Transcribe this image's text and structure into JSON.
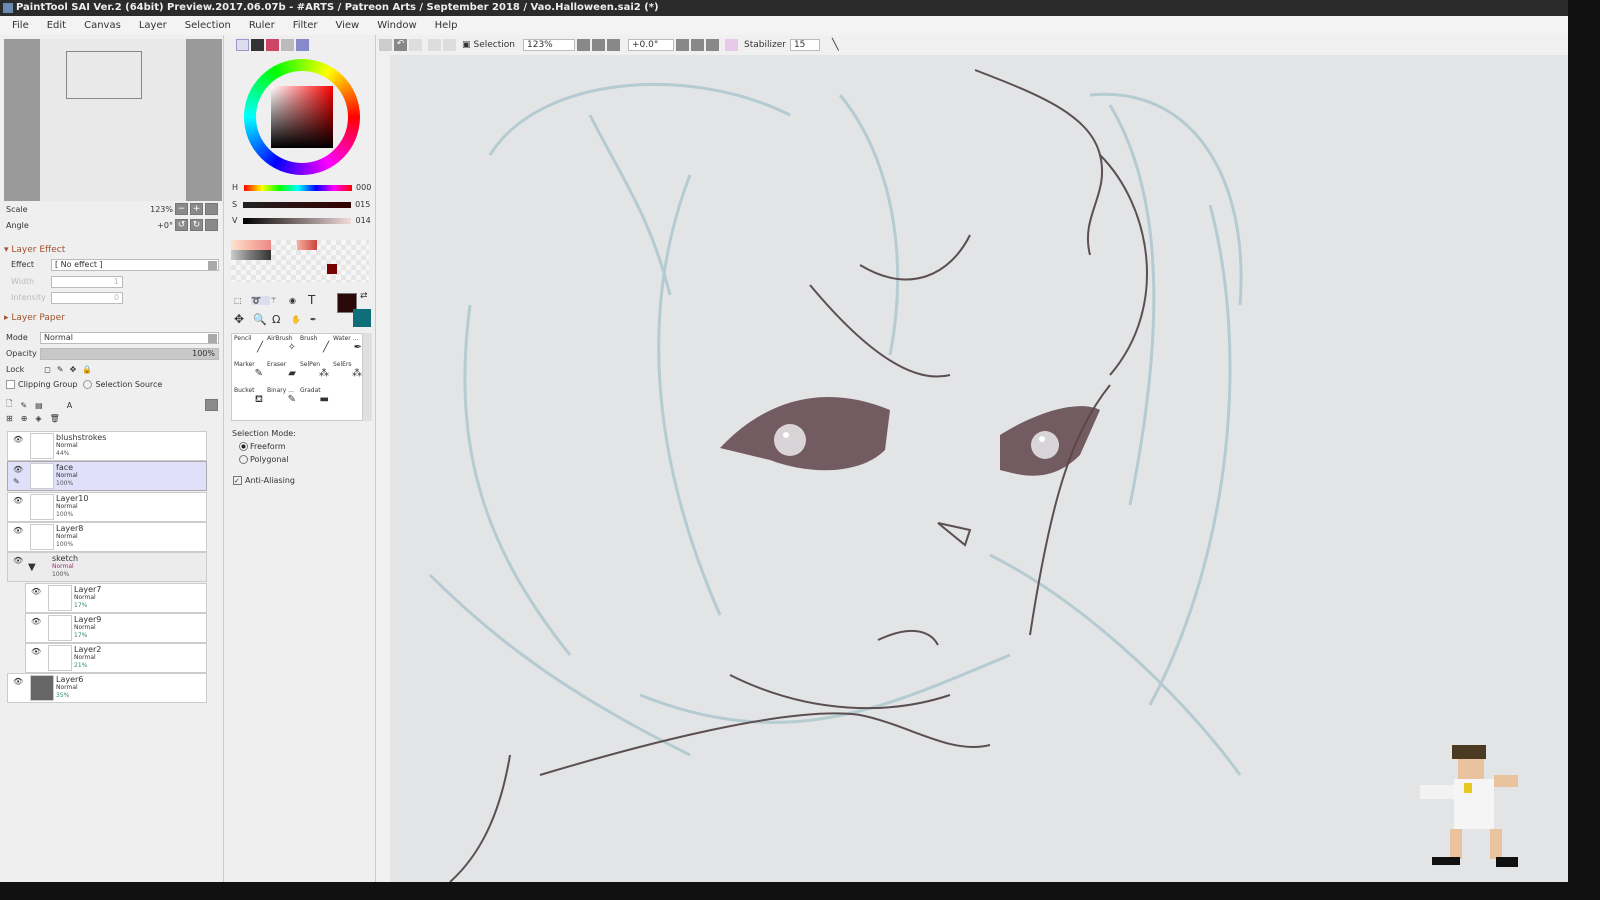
{
  "title": "PaintTool SAI Ver.2 (64bit) Preview.2017.06.07b - #ARTS / Patreon Arts / September 2018 / Vao.Halloween.sai2 (*)",
  "menu": [
    "File",
    "Edit",
    "Canvas",
    "Layer",
    "Selection",
    "Ruler",
    "Filter",
    "View",
    "Window",
    "Help"
  ],
  "navigator": {
    "scale_label": "Scale",
    "scale_value": "123%",
    "angle_label": "Angle",
    "angle_value": "+0°"
  },
  "layer_effect": {
    "header": "Layer Effect",
    "effect_label": "Effect",
    "effect_value": "[ No effect ]",
    "width_label": "Width",
    "width_value": "1",
    "intensity_label": "Intensity",
    "intensity_value": "0"
  },
  "layer_paper": {
    "header": "Layer Paper",
    "mode_label": "Mode",
    "mode_value": "Normal",
    "opacity_label": "Opacity",
    "opacity_value": "100%",
    "lock_label": "Lock",
    "clipping_label": "Clipping Group",
    "selection_source_label": "Selection Source"
  },
  "layers": [
    {
      "name": "blushstrokes",
      "mode": "Normal",
      "opacity": "44%"
    },
    {
      "name": "face",
      "mode": "Normal",
      "opacity": "100%",
      "selected": true
    },
    {
      "name": "Layer10",
      "mode": "Normal",
      "opacity": "100%"
    },
    {
      "name": "Layer8",
      "mode": "Normal",
      "opacity": "100%"
    },
    {
      "name": "sketch",
      "mode": "Normal",
      "opacity": "100%",
      "folder": true
    },
    {
      "name": "Layer7",
      "mode": "Normal",
      "opacity": "17%"
    },
    {
      "name": "Layer9",
      "mode": "Normal",
      "opacity": "17%"
    },
    {
      "name": "Layer2",
      "mode": "Normal",
      "opacity": "21%"
    },
    {
      "name": "Layer6",
      "mode": "Normal",
      "opacity": "35%"
    }
  ],
  "color": {
    "h_label": "H",
    "h": "000",
    "s_label": "S",
    "s": "015",
    "v_label": "V",
    "v": "014",
    "primary": "#2a0808",
    "secondary": "#0e6f7a"
  },
  "tools": [
    "Pencil",
    "AirBrush",
    "Brush",
    "Water ...",
    "Marker",
    "Eraser",
    "SelPen",
    "SelErs",
    "Bucket",
    "Binary ...",
    "Gradat"
  ],
  "selection_mode": {
    "label": "Selection Mode:",
    "options": [
      "Freeform",
      "Polygonal"
    ],
    "selected": "Freeform",
    "anti_aliasing": "Anti-Aliasing"
  },
  "toolbar": {
    "selection": "Selection",
    "zoom": "123%",
    "angle": "+0.0°",
    "stabilizer_label": "Stabilizer",
    "stabilizer": "15"
  }
}
